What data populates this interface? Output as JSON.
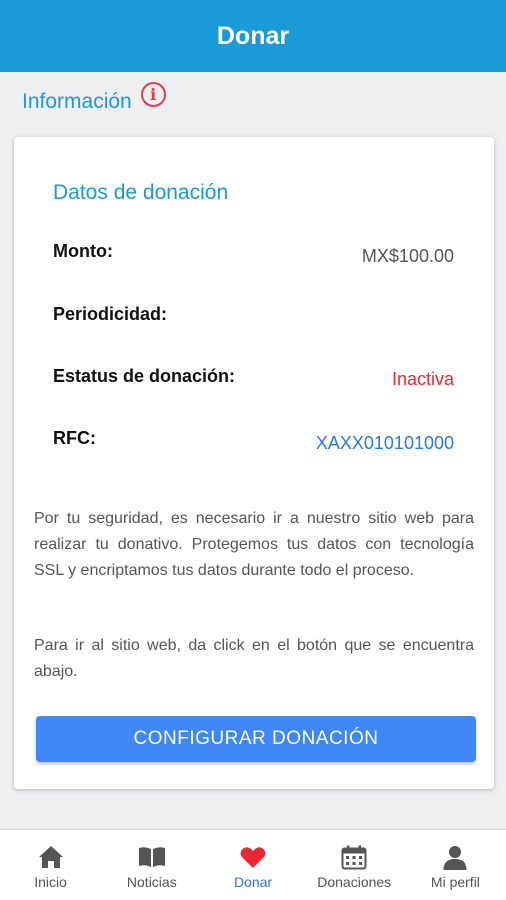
{
  "header": {
    "title": "Donar"
  },
  "info": {
    "label": "Información",
    "icon": "info-icon"
  },
  "card": {
    "title": "Datos de donación",
    "rows": [
      {
        "label": "Monto:",
        "value": "MX$100.00"
      },
      {
        "label": "Periodicidad:",
        "value": ""
      },
      {
        "label": "Estatus de donación:",
        "value": "Inactiva"
      },
      {
        "label": "RFC:",
        "value": "XAXX010101000"
      }
    ],
    "paragraph1": "Por tu seguridad, es necesario ir a nuestro sitio web para realizar tu donativo. Protegemos tus datos con tecnología SSL y encriptamos tus datos durante todo el proceso.",
    "paragraph2": "Para ir al sitio web, da click en el botón que se encuentra abajo.",
    "button_label": "CONFIGURAR DONACIÓN"
  },
  "tabbar": {
    "items": [
      {
        "label": "Inicio",
        "icon": "home-icon",
        "active": false
      },
      {
        "label": "Noticias",
        "icon": "book-icon",
        "active": false
      },
      {
        "label": "Donar",
        "icon": "heart-icon",
        "active": true
      },
      {
        "label": "Donaciones",
        "icon": "calendar-icon",
        "active": false
      },
      {
        "label": "Mi perfil",
        "icon": "person-icon",
        "active": false
      }
    ]
  },
  "colors": {
    "primary": "#1a9ad6",
    "status_inactive": "#e8282e",
    "link": "#2a78e4",
    "button": "#3f87f5",
    "active_tab_icon": "#e8282e"
  }
}
